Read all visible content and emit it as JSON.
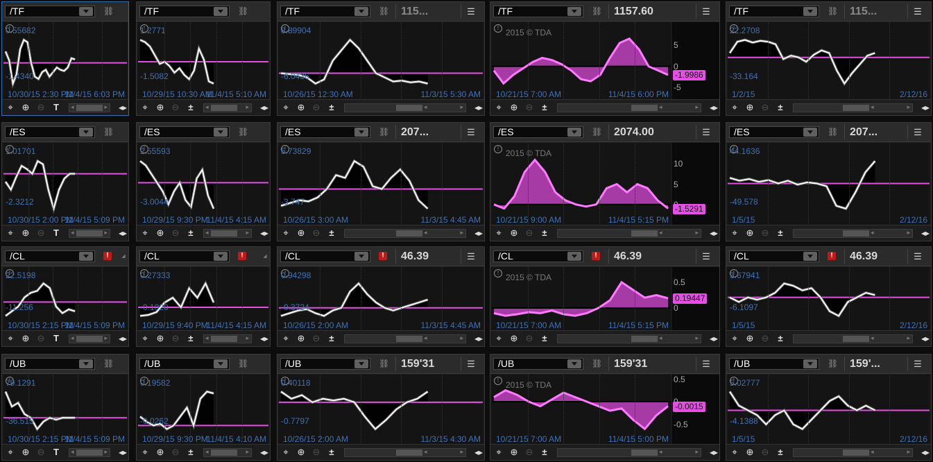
{
  "colors": {
    "accent_pink": "#e64ee6",
    "axis_label_blue": "#3f72b4",
    "alert_red": "#c31818",
    "selected_border": "#2f6fb4"
  },
  "icons": {
    "link": "link-icon",
    "menu": "hamburger-menu-icon",
    "alert": "alert-icon",
    "info": "info-icon",
    "crosshair": "crosshair-icon",
    "zoom_in": "zoom-in-icon",
    "zoom_out": "zoom-out-icon",
    "drawing": "text-drawing-icon",
    "study": "study-icon",
    "expand": "expand-icon"
  },
  "row_symbols": [
    "/TF",
    "/ES",
    "/CL",
    "/UB"
  ],
  "cells": [
    {
      "symbol": "/TF",
      "price": "",
      "alert": "",
      "type": "small",
      "tool": "T",
      "yhigh": "0.55682",
      "ylow": "-1.4340",
      "dates": [
        "10/30/15 2:30 PM",
        "11/4/15 6:03 PM"
      ],
      "watermark": "",
      "axis_ticks": [],
      "tag": "",
      "series": [
        0.5,
        0.1,
        -0.9,
        -0.5,
        0.6,
        1.0,
        0.9,
        0.0,
        -0.6,
        -0.7,
        -0.4,
        -0.3,
        -0.6,
        -0.4,
        -0.2,
        -0.3,
        -0.35,
        -0.2,
        0.2,
        0.15
      ]
    },
    {
      "symbol": "/TF",
      "price": "",
      "alert": "",
      "type": "small",
      "tool": "±",
      "yhigh": "1.2771",
      "ylow": "-1.5082",
      "dates": [
        "10/29/15 10:30 AM",
        "11/4/15 5:10 AM"
      ],
      "watermark": "",
      "axis_ticks": [],
      "tag": "",
      "series": [
        1.0,
        0.9,
        0.7,
        0.3,
        -0.1,
        0.0,
        -0.2,
        -0.5,
        -0.3,
        -0.6,
        -0.8,
        -0.4,
        0.6,
        0.1,
        -0.9,
        -1.0
      ]
    },
    {
      "symbol": "/TF",
      "price": "115...",
      "alert": "",
      "type": "medium",
      "tool": "±",
      "yhigh": "8.89904",
      "ylow": "-6.0436",
      "dates": [
        "10/26/15 12:30 AM",
        "11/3/15 5:30 AM"
      ],
      "watermark": "",
      "axis_ticks": [],
      "tag": "",
      "series": [
        0.0,
        -0.2,
        -0.4,
        -1.0,
        -2.5,
        -1.5,
        3.0,
        5.5,
        8.0,
        6.0,
        3.0,
        0.0,
        -1.0,
        -2.0,
        -1.8,
        -2.2,
        -2.0,
        -2.5
      ]
    },
    {
      "symbol": "/TF",
      "price": "1157.60",
      "alert": "",
      "type": "large",
      "tool": "±",
      "yhigh": "",
      "ylow": "",
      "dates": [
        "10/21/15 7:00 AM",
        "11/4/15 6:00 PM"
      ],
      "watermark": "2015 © TDA",
      "axis_ticks": [
        "5",
        "0",
        "-5"
      ],
      "tag": "-1.9986",
      "series": [
        -1.0,
        -4.0,
        -2.0,
        -0.5,
        1.0,
        2.0,
        1.5,
        0.5,
        -1.0,
        -3.0,
        -3.5,
        -2.0,
        2.0,
        5.5,
        6.5,
        4.0,
        0.0,
        -1.0,
        -2.0
      ]
    },
    {
      "symbol": "/TF",
      "price": "115...",
      "alert": "",
      "type": "medium",
      "tool": "±",
      "yhigh": "22.2708",
      "ylow": "-33.164",
      "dates": [
        "1/2/15",
        "2/12/16"
      ],
      "watermark": "",
      "axis_ticks": [],
      "tag": "",
      "series": [
        5,
        18,
        20,
        17,
        19,
        18,
        15,
        -2,
        2,
        0,
        -5,
        3,
        8,
        5,
        -15,
        -30,
        -18,
        -8,
        2,
        5
      ]
    },
    {
      "symbol": "/ES",
      "price": "",
      "alert": "",
      "type": "small",
      "tool": "T",
      "yhigh": "1.01701",
      "ylow": "-2.3212",
      "dates": [
        "10/30/15 2:00 PM",
        "11/4/15 5:09 PM"
      ],
      "watermark": "",
      "axis_ticks": [],
      "tag": "",
      "series": [
        -0.5,
        -1.0,
        -0.2,
        0.5,
        0.3,
        0.0,
        0.8,
        0.6,
        -1.0,
        -2.2,
        -1.0,
        -0.3,
        0.0,
        0.0
      ]
    },
    {
      "symbol": "/ES",
      "price": "",
      "alert": "",
      "type": "small",
      "tool": "±",
      "yhigh": "2.55593",
      "ylow": "-3.0044",
      "dates": [
        "10/29/15 9:30 PM",
        "11/4/15 4:15 AM"
      ],
      "watermark": "",
      "axis_ticks": [],
      "tag": "",
      "series": [
        2.5,
        2.0,
        1.0,
        0.0,
        -1.0,
        -2.5,
        -1.0,
        0.0,
        -2.0,
        -2.8,
        0.5,
        1.5,
        -1.5,
        -3.0
      ]
    },
    {
      "symbol": "/ES",
      "price": "207...",
      "alert": "",
      "type": "medium",
      "tool": "±",
      "yhigh": "5.73829",
      "ylow": "-3.747",
      "dates": [
        "10/26/15 3:00 AM",
        "11/3/15 4:45 AM"
      ],
      "watermark": "",
      "axis_ticks": [],
      "tag": "",
      "series": [
        -3.0,
        -2.5,
        -2.0,
        -2.2,
        -1.5,
        0.0,
        2.5,
        2.0,
        5.0,
        4.0,
        0.5,
        0.0,
        2.0,
        3.5,
        1.5,
        -2.0,
        -3.5
      ]
    },
    {
      "symbol": "/ES",
      "price": "2074.00",
      "alert": "",
      "type": "large",
      "tool": "±",
      "yhigh": "",
      "ylow": "",
      "dates": [
        "10/21/15 9:00 AM",
        "11/4/15 5:15 PM"
      ],
      "watermark": "2015 © TDA",
      "axis_ticks": [
        "10",
        "5",
        "0"
      ],
      "tag": "-1.5291",
      "series": [
        0.0,
        -1.0,
        2.0,
        8.0,
        11.0,
        8.0,
        3.0,
        1.0,
        0.0,
        -0.5,
        0.0,
        4.0,
        5.0,
        3.0,
        5.0,
        4.0,
        1.0,
        -1.0
      ]
    },
    {
      "symbol": "/ES",
      "price": "207...",
      "alert": "",
      "type": "medium",
      "tool": "±",
      "yhigh": "44.1636",
      "ylow": "-49.578",
      "dates": [
        "1/5/15",
        "2/12/16"
      ],
      "watermark": "",
      "axis_ticks": [],
      "tag": "",
      "series": [
        10,
        5,
        8,
        3,
        6,
        0,
        5,
        -2,
        2,
        0,
        -5,
        -40,
        -45,
        -15,
        20,
        40
      ]
    },
    {
      "symbol": "/CL",
      "price": "",
      "alert": "!",
      "type": "small",
      "tool": "T",
      "yhigh": "22.5198",
      "ylow": "-11.256",
      "dates": [
        "10/30/15 2:15 PM",
        "11/4/15 5:09 PM"
      ],
      "watermark": "",
      "axis_ticks": [],
      "tag": "",
      "series": [
        -15,
        -10,
        -5,
        5,
        10,
        12,
        20,
        15,
        -5,
        -12,
        -8,
        -10
      ]
    },
    {
      "symbol": "/CL",
      "price": "",
      "alert": "!",
      "type": "small",
      "tool": "±",
      "yhigh": "0.27333",
      "ylow": "-0.1020",
      "dates": [
        "10/29/15 9:40 PM",
        "11/4/15 4:15 AM"
      ],
      "watermark": "",
      "axis_ticks": [],
      "tag": "",
      "series": [
        -0.09,
        -0.08,
        -0.05,
        0.05,
        0.1,
        0.0,
        0.2,
        0.1,
        0.25,
        0.05
      ]
    },
    {
      "symbol": "/CL",
      "price": "46.39",
      "alert": "!",
      "type": "medium",
      "tool": "±",
      "yhigh": "0.94298",
      "ylow": "-0.3724",
      "dates": [
        "10/26/15 2:00 AM",
        "11/3/15 4:45 AM"
      ],
      "watermark": "",
      "axis_ticks": [],
      "tag": "",
      "series": [
        -0.3,
        -0.2,
        -0.1,
        -0.05,
        -0.2,
        -0.3,
        -0.1,
        0.0,
        0.6,
        0.9,
        0.5,
        0.2,
        0.0,
        -0.1,
        0.0,
        0.1,
        0.2,
        0.3
      ]
    },
    {
      "symbol": "/CL",
      "price": "46.39",
      "alert": "!",
      "type": "large",
      "tool": "±",
      "yhigh": "",
      "ylow": "",
      "dates": [
        "10/21/15 7:00 AM",
        "11/4/15 5:15 PM"
      ],
      "watermark": "2015 © TDA",
      "axis_ticks": [
        "0.5",
        "0"
      ],
      "tag": "0.19447",
      "series": [
        -0.1,
        -0.15,
        -0.12,
        -0.08,
        -0.1,
        -0.05,
        -0.12,
        -0.15,
        -0.1,
        0.0,
        0.15,
        0.5,
        0.35,
        0.2,
        0.25,
        0.19
      ]
    },
    {
      "symbol": "/CL",
      "price": "46.39",
      "alert": "!",
      "type": "medium",
      "tool": "±",
      "yhigh": "3.67941",
      "ylow": "-6.1097",
      "dates": [
        "1/5/15",
        "2/12/16"
      ],
      "watermark": "",
      "axis_ticks": [],
      "tag": "",
      "series": [
        0,
        -1,
        0,
        -0.5,
        0,
        1,
        3,
        2.5,
        1.5,
        2.0,
        0,
        -3,
        -4,
        -1,
        0,
        1,
        0.5
      ]
    },
    {
      "symbol": "/UB",
      "price": "",
      "alert": "",
      "type": "small",
      "tool": "T",
      "yhigh": "79.1291",
      "ylow": "-36.515",
      "dates": [
        "10/30/15 2:15 PM",
        "11/4/15 5:09 PM"
      ],
      "watermark": "",
      "axis_ticks": [],
      "tag": "",
      "series": [
        70,
        30,
        40,
        10,
        0,
        -30,
        -10,
        0,
        -5,
        0,
        0,
        0
      ]
    },
    {
      "symbol": "/UB",
      "price": "",
      "alert": "",
      "type": "small",
      "tool": "±",
      "yhigh": "0.19582",
      "ylow": "-0.0262",
      "dates": [
        "10/29/15 9:30 PM",
        "11/4/15 4:10 AM"
      ],
      "watermark": "",
      "axis_ticks": [],
      "tag": "",
      "series": [
        0.05,
        0.02,
        0.0,
        0.01,
        -0.02,
        0.0,
        0.05,
        0.1,
        0.0,
        0.15,
        0.19,
        0.18
      ]
    },
    {
      "symbol": "/UB",
      "price": "159'31",
      "alert": "",
      "type": "medium",
      "tool": "±",
      "yhigh": "0.40118",
      "ylow": "-0.7797",
      "dates": [
        "10/26/15 2:00 AM",
        "11/3/15 4:30 AM"
      ],
      "watermark": "",
      "axis_ticks": [],
      "tag": "",
      "series": [
        0.3,
        0.1,
        0.2,
        0.0,
        0.1,
        0.05,
        0.1,
        0.0,
        -0.4,
        -0.75,
        -0.5,
        -0.2,
        0.0,
        0.1,
        0.3
      ]
    },
    {
      "symbol": "/UB",
      "price": "159'31",
      "alert": "",
      "type": "large",
      "tool": "±",
      "yhigh": "",
      "ylow": "",
      "dates": [
        "10/21/15 7:00 AM",
        "11/4/15 5:00 PM"
      ],
      "watermark": "2015 © TDA",
      "axis_ticks": [
        "0.5",
        "0",
        "-0.5"
      ],
      "tag": "-0.0015",
      "series": [
        0.1,
        0.25,
        0.15,
        0.0,
        -0.1,
        0.05,
        0.2,
        0.1,
        0.0,
        -0.1,
        -0.2,
        -0.15,
        -0.4,
        -0.6,
        -0.3,
        -0.1
      ]
    },
    {
      "symbol": "/UB",
      "price": "159'...",
      "alert": "",
      "type": "medium",
      "tool": "±",
      "yhigh": "5.02777",
      "ylow": "-4.1388",
      "dates": [
        "1/5/15",
        "2/12/16"
      ],
      "watermark": "",
      "axis_ticks": [],
      "tag": "",
      "series": [
        4,
        1,
        0,
        -1,
        -3,
        -1,
        0,
        -3,
        -4,
        -2,
        0,
        2,
        3,
        1,
        0,
        1,
        0
      ]
    }
  ]
}
